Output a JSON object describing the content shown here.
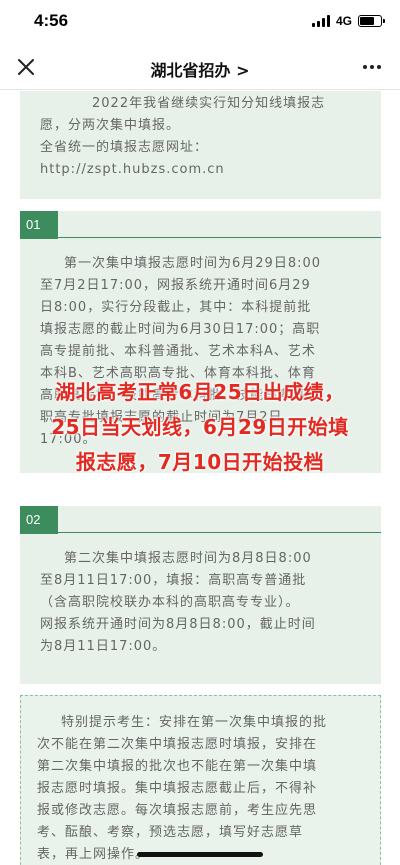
{
  "status_bar": {
    "time": "4:56",
    "network": "4G"
  },
  "nav": {
    "title": "湖北省招办 >",
    "close_icon": "close-icon",
    "more_icon": "more-icon"
  },
  "article": {
    "intro": {
      "lines": [
        "2022年我省继续实行知分知线填报志",
        "愿，分两次集中填报。",
        "全省统一的填报志愿网址：",
        "http://zspt.hubzs.com.cn"
      ]
    },
    "section1": {
      "number": "01",
      "lines": [
        "第一次集中填报志愿时间为6月29日8:00",
        "至7月2日17:00，网报系统开通时间6月29",
        "日8:00，实行分段截止，其中：本科提前批",
        "填报志愿的截止时间为6月30日17:00；高职",
        "高专提前批、本科普通批、艺术本科A、艺术",
        "本科B、艺术高职高专批、体育本科批、体育",
        "高职高专批、技能高考本科批、技能高考高",
        "职高专批填报志愿的截止时间为7月2日",
        "17:00。"
      ]
    },
    "section2": {
      "number": "02",
      "lines": [
        "第二次集中填报志愿时间为8月8日8:00",
        "至8月11日17:00，填报：高职高专普通批",
        "（含高职院校联办本科的高职高专专业）。",
        "网报系统开通时间为8月8日8:00，截止时间",
        "为8月11日17:00。"
      ]
    },
    "notice": {
      "lines": [
        "特别提示考生：安排在第一次集中填报的批",
        "次不能在第二次集中填报志愿时填报，安排在",
        "第二次集中填报的批次也不能在第一次集中填",
        "报志愿时填报。集中填报志愿截止后，不得补",
        "报或修改志愿。每次填报志愿前，考生应先思",
        "考、酝酿、考察，预选志愿，填写好志愿草",
        "表，再上网操作。"
      ]
    }
  },
  "overlay": {
    "lines": [
      "湖北高考正常6月25日出成绩，",
      "25日当天划线，6月29日开始填",
      "报志愿，7月10日开始投档"
    ],
    "color": "#e12a21"
  },
  "colors": {
    "accent_green": "#3d8c5e",
    "card_bg": "#e7f1e9"
  }
}
